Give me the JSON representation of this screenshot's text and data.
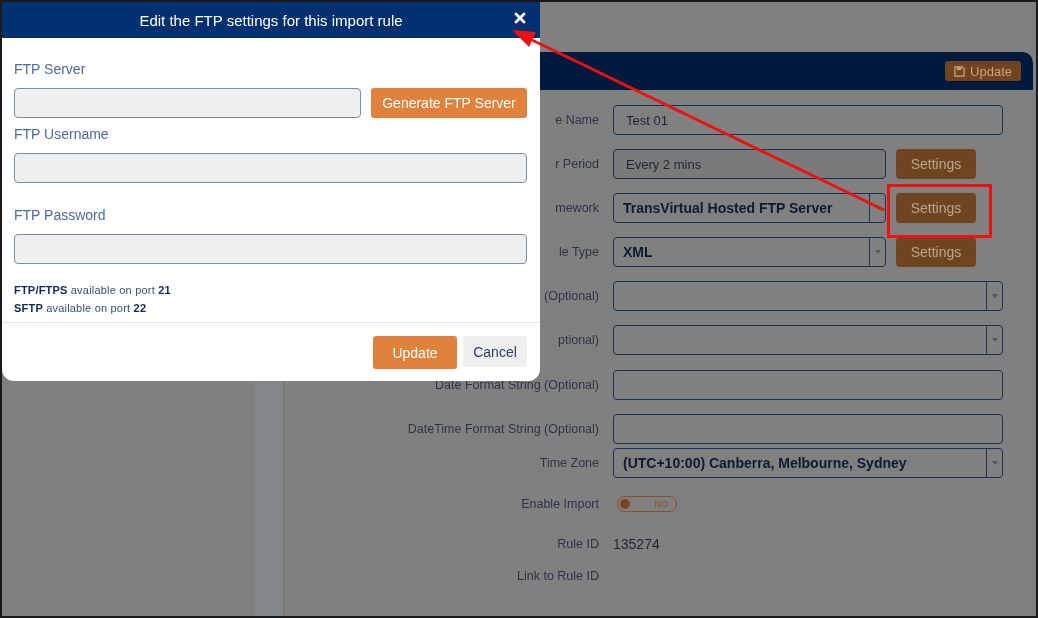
{
  "dialog": {
    "title": "Edit the FTP settings for this import rule",
    "fields": [
      {
        "label": "FTP Server",
        "button": "Generate FTP Server"
      },
      {
        "label": "FTP Username"
      },
      {
        "label": "FTP Password"
      }
    ],
    "notes": [
      "**FTP/FTPS** available on port **21**",
      "**SFTP** available on port **22**"
    ],
    "update_button": "Update",
    "cancel_button": "Cancel"
  },
  "page": {
    "toolbar_button": "Update",
    "rows": [
      {
        "kind": "input",
        "label": "e Name",
        "value": "Test 01"
      },
      {
        "kind": "input-button",
        "label": "r Period",
        "value": "Every 2 mins",
        "button": "Settings"
      },
      {
        "kind": "select-button",
        "label": "mework",
        "value": "TransVirtual Hosted FTP Server",
        "button": "Settings"
      },
      {
        "kind": "select-button",
        "label": "le Type",
        "value": "XML",
        "button": "Settings"
      },
      {
        "kind": "select",
        "label": "(Optional)"
      },
      {
        "kind": "select",
        "label": "ptional)"
      },
      {
        "kind": "input",
        "label": "Date Format String (Optional)"
      },
      {
        "kind": "input",
        "label": "DateTime Format String (Optional)"
      },
      {
        "kind": "select",
        "label": "Time Zone",
        "value": "(UTC+10:00) Canberra, Melbourne, Sydney"
      },
      {
        "kind": "toggle",
        "label": "Enable Import",
        "on": false,
        "value": "NO"
      },
      {
        "kind": "static",
        "label": "Rule ID",
        "value": "135274"
      },
      {
        "kind": "static",
        "label": "Link to Rule ID"
      }
    ]
  }
}
